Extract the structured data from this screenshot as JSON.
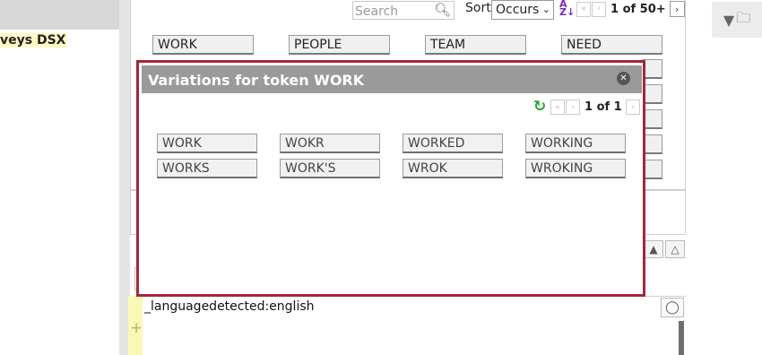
{
  "sidebar": {
    "project_label": "veys DSX"
  },
  "search": {
    "placeholder": "Search"
  },
  "sort": {
    "label": "Sort",
    "selected": "Occurs"
  },
  "pager": {
    "page_text": "1 of 50+"
  },
  "tokens": [
    "WORK",
    "PEOPLE",
    "TEAM",
    "NEED"
  ],
  "icons": {
    "search": "search-icon",
    "az_sort": "sort-az-icon",
    "filter": "filter-icon",
    "folder": "folder-icon",
    "close": "close-icon",
    "refresh": "refresh-icon",
    "bulb": "lightbulb-icon",
    "plus": "plus-icon"
  },
  "modal": {
    "title": "Variations for token WORK",
    "page_text": "1 of 1",
    "variations": [
      "WORK",
      "WOKR",
      "WORKED",
      "WORKING",
      "WORKS",
      "WORK'S",
      "WROK",
      "WROKING"
    ]
  },
  "editor": {
    "text": "_languagedetected:english"
  },
  "colors": {
    "modal_border": "#a32638",
    "modal_header": "#9a9a9a",
    "gutter": "#fbf8b6",
    "refresh": "#2aa52a"
  }
}
